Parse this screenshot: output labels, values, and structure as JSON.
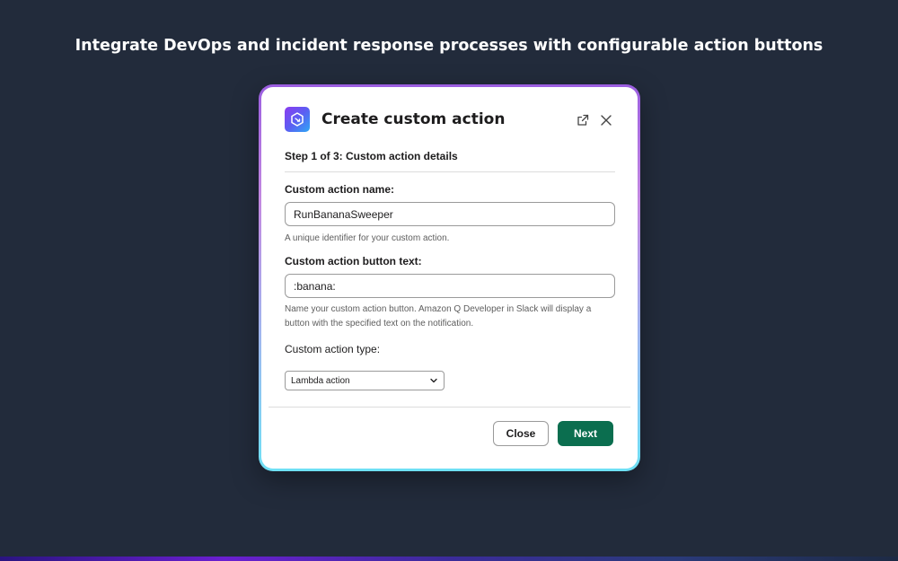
{
  "headline": "Integrate DevOps and incident response processes with configurable action buttons",
  "modal": {
    "title": "Create custom action",
    "step": "Step 1 of 3: Custom action details",
    "fields": {
      "name": {
        "label": "Custom action name:",
        "value": "RunBananaSweeper",
        "help": "A unique identifier for your custom action."
      },
      "button_text": {
        "label": "Custom action button text:",
        "value": ":banana:",
        "help": "Name your custom action button. Amazon Q Developer in Slack will display a button with the specified text on the notification."
      },
      "type": {
        "label": "Custom action type:",
        "selected": "Lambda action"
      }
    },
    "buttons": {
      "close": "Close",
      "next": "Next"
    }
  },
  "icons": {
    "app": "amazon-q-icon",
    "external": "external-link-icon",
    "close": "close-icon",
    "dropdown": "chevron-down-icon"
  },
  "colors": {
    "background": "#222b3b",
    "primary_button": "#0b6e4f",
    "frame_gradient_top": "#9b5ee0",
    "frame_gradient_bottom": "#6ee0f5"
  }
}
